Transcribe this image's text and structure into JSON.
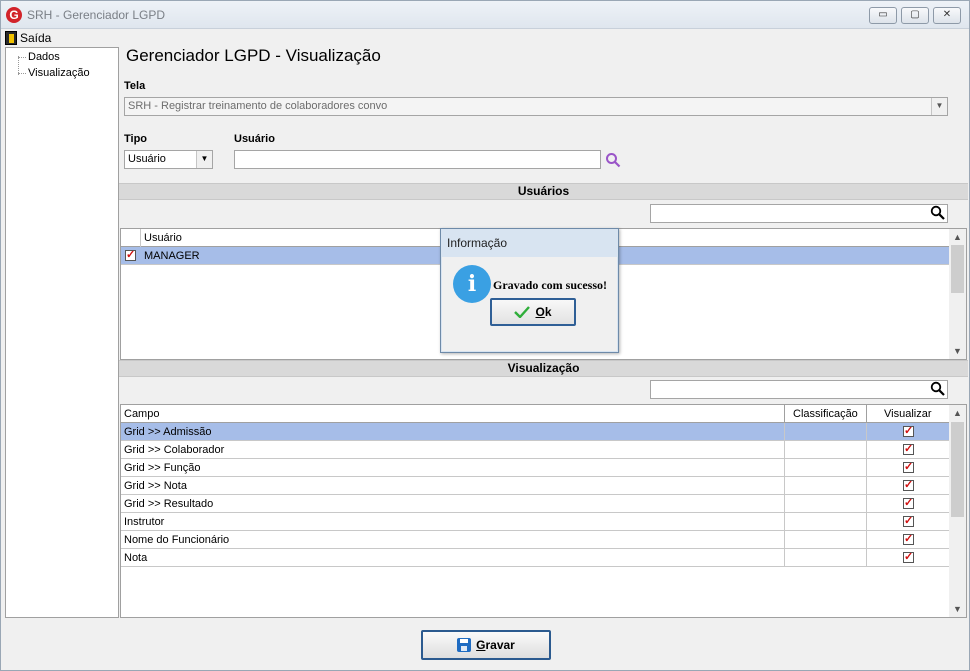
{
  "window": {
    "title": "SRH - Gerenciador LGPD",
    "app_icon": "G",
    "minimize": "▭",
    "maximize": "▢",
    "close": "✕"
  },
  "menu": {
    "exit": "Saída"
  },
  "tree": {
    "items": [
      "Dados",
      "Visualização"
    ]
  },
  "page": {
    "title": "Gerenciador LGPD - Visualização"
  },
  "form": {
    "tela_label": "Tela",
    "tela_value": "SRH - Registrar treinamento de colaboradores convo",
    "tipo_label": "Tipo",
    "tipo_value": "Usuário",
    "usuario_label": "Usuário",
    "usuario_value": ""
  },
  "users_section": {
    "title": "Usuários",
    "search_value": "",
    "column": "Usuário",
    "rows": [
      {
        "name": "MANAGER",
        "checked": true
      }
    ]
  },
  "view_section": {
    "title": "Visualização",
    "search_value": "",
    "columns": [
      "Campo",
      "Classificação",
      "Visualizar"
    ],
    "rows": [
      {
        "campo": "Grid >> Admissão",
        "classificacao": "",
        "visualizar": true
      },
      {
        "campo": "Grid >> Colaborador",
        "classificacao": "",
        "visualizar": true
      },
      {
        "campo": "Grid >> Função",
        "classificacao": "",
        "visualizar": true
      },
      {
        "campo": "Grid >> Nota",
        "classificacao": "",
        "visualizar": true
      },
      {
        "campo": "Grid >> Resultado",
        "classificacao": "",
        "visualizar": true
      },
      {
        "campo": "Instrutor",
        "classificacao": "",
        "visualizar": true
      },
      {
        "campo": "Nome do Funcionário",
        "classificacao": "",
        "visualizar": true
      },
      {
        "campo": "Nota",
        "classificacao": "",
        "visualizar": true
      }
    ]
  },
  "dialog": {
    "title": "Informação",
    "icon": "i",
    "message": "Gravado com sucesso!",
    "ok_mnemonic": "O",
    "ok_rest": "k"
  },
  "footer": {
    "save_mnemonic": "G",
    "save_rest": "ravar"
  },
  "colors": {
    "accent_border": "#2b5a8f",
    "selection": "#a6bde8",
    "info_blue": "#3aa0e3",
    "check_red": "#d01010"
  }
}
